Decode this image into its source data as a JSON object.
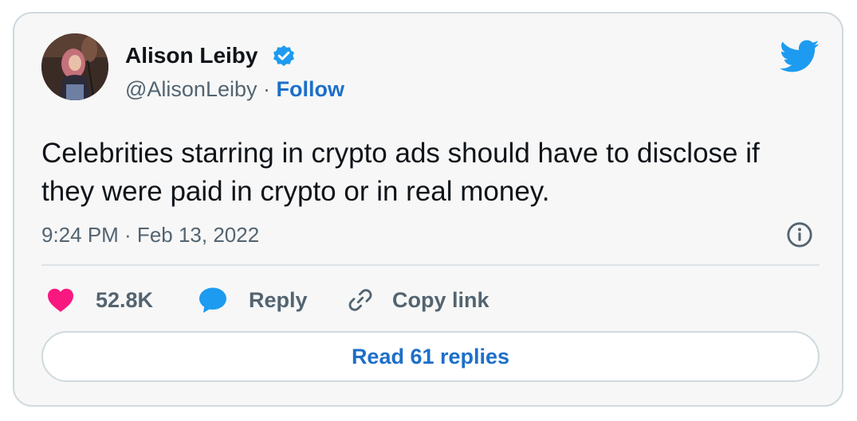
{
  "author": {
    "name": "Alison Leiby",
    "handle": "@AlisonLeiby",
    "separator": " · ",
    "follow_label": "Follow",
    "verified": true
  },
  "tweet": {
    "text": "Celebrities starring in crypto ads should have to disclose if they were paid in crypto or in real money.",
    "timestamp": "9:24 PM · Feb 13, 2022"
  },
  "actions": {
    "like_count": "52.8K",
    "reply_label": "Reply",
    "copy_link_label": "Copy link"
  },
  "read_replies_label": "Read 61 replies",
  "icons": {
    "verified": "verified-badge-icon",
    "brand": "twitter-bird-icon",
    "info": "info-icon",
    "like": "heart-icon",
    "reply": "speech-bubble-icon",
    "copy": "link-icon"
  },
  "colors": {
    "twitter_blue": "#1d9bf0",
    "link_blue": "#1d6fc9",
    "like_pink": "#f91880",
    "text_primary": "#0f1419",
    "text_secondary": "#536471",
    "card_background": "#f7f7f7",
    "border": "#cfd9de"
  }
}
